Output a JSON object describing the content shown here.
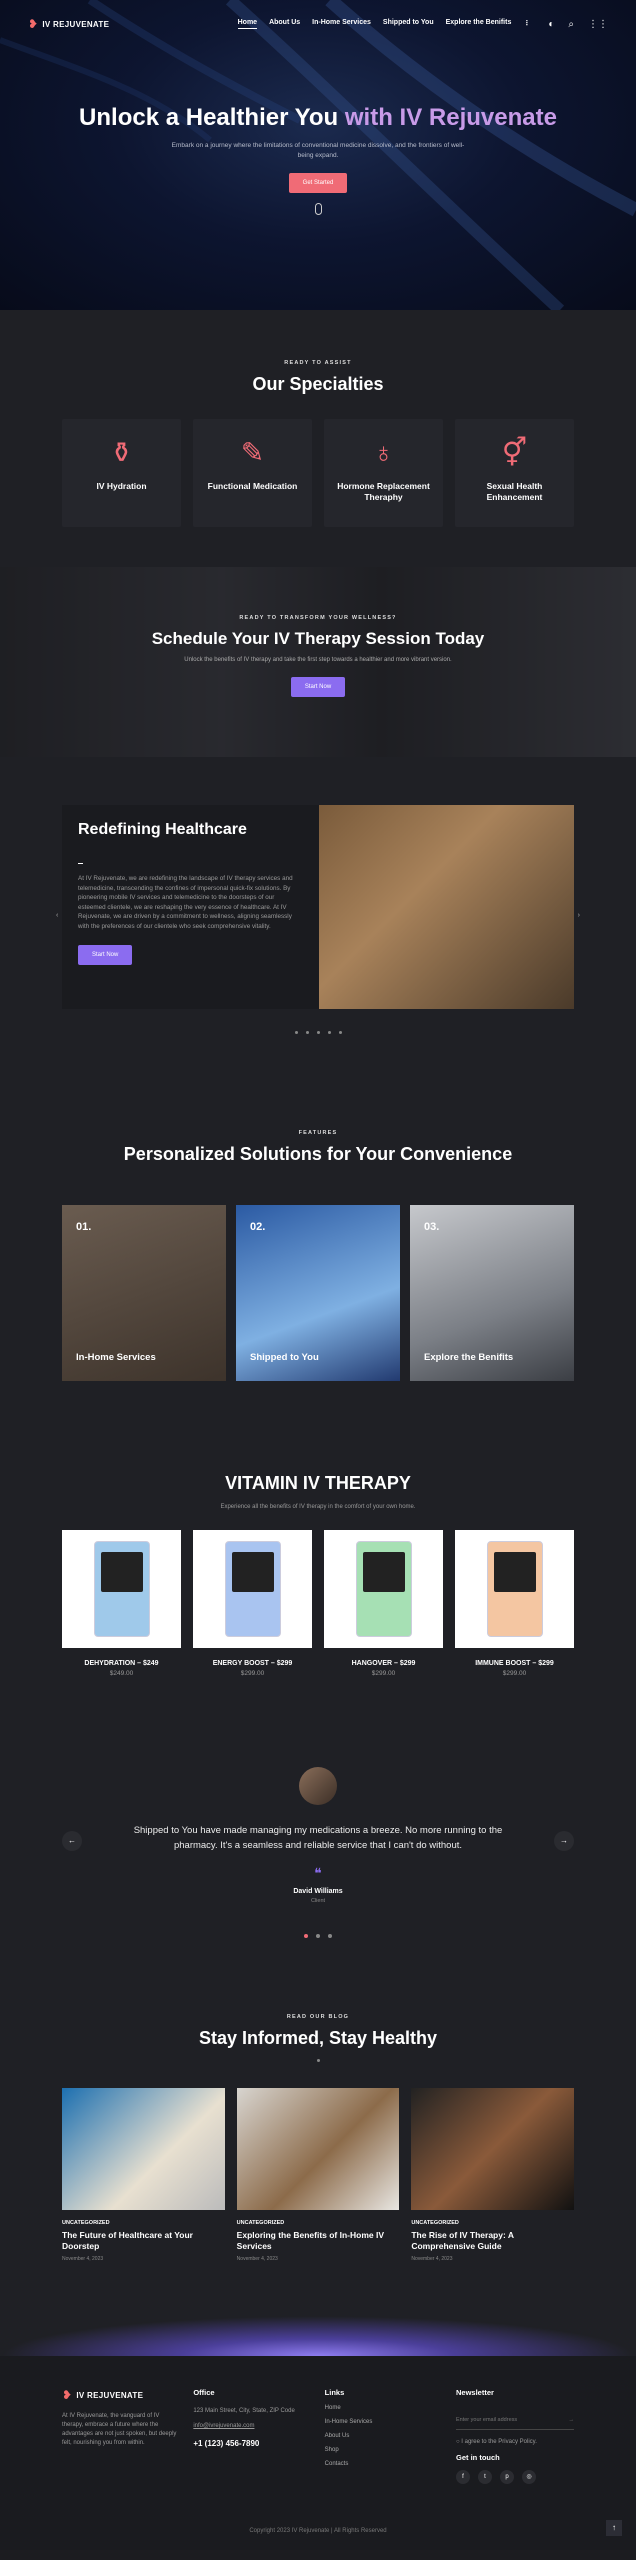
{
  "nav": {
    "logo": "IV REJUVENATE",
    "links": [
      "Home",
      "About Us",
      "In-Home Services",
      "Shipped to You",
      "Explore the Benifits"
    ]
  },
  "hero": {
    "title_a": "Unlock a Healthier You",
    "title_b": "with IV Rejuvenate",
    "text": "Embark on a journey where the limitations of conventional medicine dissolve, and the frontiers of well-being expand.",
    "cta": "Get Started"
  },
  "spec": {
    "kicker": "READY TO ASSIST",
    "title": "Our Specialties",
    "cards": [
      "IV Hydration",
      "Functional Medication",
      "Hormone Replacement Theraphy",
      "Sexual Health Enhancement"
    ]
  },
  "banner": {
    "kicker": "READY TO TRANSFORM YOUR WELLNESS?",
    "title": "Schedule Your IV Therapy Session Today",
    "text": "Unlock the benefits of IV therapy and take the first step towards a healthier and more vibrant version.",
    "cta": "Start Now"
  },
  "redef": {
    "title": "Redefining Healthcare",
    "text": "At IV Rejuvenate, we are redefining the landscape of IV therapy services and telemedicine, transcending the confines of impersonal quick-fix solutions. By pioneering mobile IV services and telemedicine to the doorsteps of our esteemed clientele, we are reshaping the very essence of healthcare. At IV Rejuvenate, we are driven by a commitment to wellness, aligning seamlessly with the preferences of our clientele who seek comprehensive vitality.",
    "cta": "Start Now"
  },
  "features": {
    "kicker": "FEATURES",
    "title": "Personalized Solutions for Your Convenience",
    "items": [
      {
        "num": "01.",
        "label": "In-Home Services"
      },
      {
        "num": "02.",
        "label": "Shipped to You"
      },
      {
        "num": "03.",
        "label": "Explore the Benifits"
      }
    ]
  },
  "vitamin": {
    "title": "VITAMIN IV THERAPY",
    "sub": "Experience all the benefits of IV therapy in the comfort of your own home.",
    "products": [
      {
        "name": "DEHYDRATION – $249",
        "price": "$249.00",
        "color": "#9fc9ea"
      },
      {
        "name": "ENERGY BOOST – $299",
        "price": "$299.00",
        "color": "#a9c4f0"
      },
      {
        "name": "HANGOVER – $299",
        "price": "$299.00",
        "color": "#a6e0b4"
      },
      {
        "name": "IMMUNE BOOST – $299",
        "price": "$299.00",
        "color": "#f4c6a2"
      }
    ]
  },
  "testimonial": {
    "quote": "Shipped to You have made managing my medications a breeze. No more running to the pharmacy. It's a seamless and reliable service that I can't do without.",
    "name": "David Williams",
    "role": "Client"
  },
  "blog": {
    "kicker": "READ OUR BLOG",
    "title": "Stay Informed, Stay Healthy",
    "posts": [
      {
        "cat": "UNCATEGORIZED",
        "title": "The Future of Healthcare at Your Doorstep",
        "date": "November 4, 2023"
      },
      {
        "cat": "UNCATEGORIZED",
        "title": "Exploring the Benefits of In-Home IV Services",
        "date": "November 4, 2023"
      },
      {
        "cat": "UNCATEGORIZED",
        "title": "The Rise of IV Therapy: A Comprehensive Guide",
        "date": "November 4, 2023"
      }
    ]
  },
  "footer": {
    "about": "At IV Rejuvenate, the vanguard of IV therapy, embrace a future where the advantages are not just spoken, but deeply felt, nourishing you from within.",
    "office_h": "Office",
    "address": "123 Main Street, City, State, ZIP Code",
    "email": "info@ivrejuvenate.com",
    "phone": "+1 (123) 456-7890",
    "links_h": "Links",
    "links": [
      "Home",
      "In-Home Services",
      "About Us",
      "Shop",
      "Contacts"
    ],
    "news_h": "Newsletter",
    "news_ph": "Enter your email address",
    "agree": "I agree to the Privacy Policy.",
    "touch": "Get in touch",
    "copyright": "Copyright 2023 IV Rejuvenate | All Rights Reserved"
  }
}
